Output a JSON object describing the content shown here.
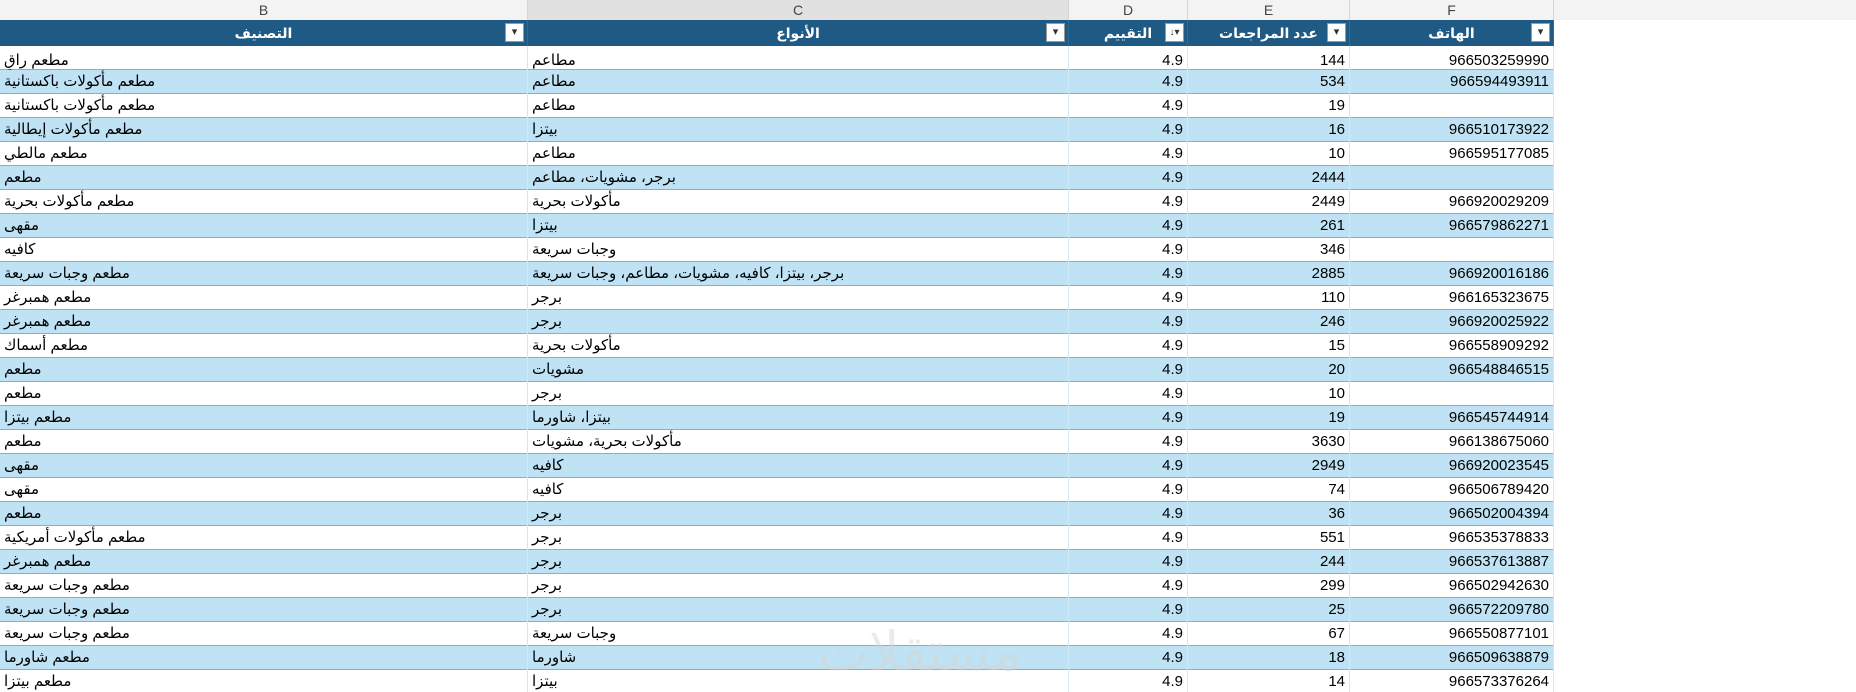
{
  "column_letters": [
    "B",
    "C",
    "D",
    "E",
    "F"
  ],
  "headers": {
    "B": "التصنيف",
    "C": "الأنواع",
    "D": "التقييم",
    "E": "عدد المراجعات",
    "F": "الهاتف"
  },
  "filter_icons": {
    "B": "filter-dropdown-icon",
    "C": "filter-dropdown-icon",
    "D": "sort-descending-filter-icon",
    "E": "filter-dropdown-icon",
    "F": "filter-dropdown-icon"
  },
  "filter_glyphs": {
    "dropdown": "▾",
    "sorted": "↓▾"
  },
  "rows": [
    {
      "category": "مطعم راقٍ",
      "types": "مطاعم",
      "rating": "4.9",
      "reviews": "144",
      "phone": "966503259990"
    },
    {
      "category": "مطعم مأكولات باكستانية",
      "types": "مطاعم",
      "rating": "4.9",
      "reviews": "534",
      "phone": "966594493911"
    },
    {
      "category": "مطعم مأكولات باكستانية",
      "types": "مطاعم",
      "rating": "4.9",
      "reviews": "19",
      "phone": ""
    },
    {
      "category": "مطعم مأكولات إيطالية",
      "types": "بيتزا",
      "rating": "4.9",
      "reviews": "16",
      "phone": "966510173922"
    },
    {
      "category": "مطعم مالطي",
      "types": "مطاعم",
      "rating": "4.9",
      "reviews": "10",
      "phone": "966595177085"
    },
    {
      "category": "مطعم",
      "types": "برجر، مشويات، مطاعم",
      "rating": "4.9",
      "reviews": "2444",
      "phone": ""
    },
    {
      "category": "مطعم مأكولات بحرية",
      "types": "مأكولات بحرية",
      "rating": "4.9",
      "reviews": "2449",
      "phone": "966920029209"
    },
    {
      "category": "مقهى",
      "types": "بيتزا",
      "rating": "4.9",
      "reviews": "261",
      "phone": "966579862271"
    },
    {
      "category": "كافيه",
      "types": "وجبات سريعة",
      "rating": "4.9",
      "reviews": "346",
      "phone": ""
    },
    {
      "category": "مطعم وجبات سريعة",
      "types": "برجر، بيتزا، كافيه، مشويات، مطاعم، وجبات سريعة",
      "rating": "4.9",
      "reviews": "2885",
      "phone": "966920016186"
    },
    {
      "category": "مطعم همبرغر",
      "types": "برجر",
      "rating": "4.9",
      "reviews": "110",
      "phone": "966165323675"
    },
    {
      "category": "مطعم همبرغر",
      "types": "برجر",
      "rating": "4.9",
      "reviews": "246",
      "phone": "966920025922"
    },
    {
      "category": "مطعم أسماك",
      "types": "مأكولات بحرية",
      "rating": "4.9",
      "reviews": "15",
      "phone": "966558909292"
    },
    {
      "category": "مطعم",
      "types": "مشويات",
      "rating": "4.9",
      "reviews": "20",
      "phone": "966548846515"
    },
    {
      "category": "مطعم",
      "types": "برجر",
      "rating": "4.9",
      "reviews": "10",
      "phone": ""
    },
    {
      "category": "مطعم بيتزا",
      "types": "بيتزا، شاورما",
      "rating": "4.9",
      "reviews": "19",
      "phone": "966545744914"
    },
    {
      "category": "مطعم",
      "types": "مأكولات بحرية، مشويات",
      "rating": "4.9",
      "reviews": "3630",
      "phone": "966138675060"
    },
    {
      "category": "مقهى",
      "types": "كافيه",
      "rating": "4.9",
      "reviews": "2949",
      "phone": "966920023545"
    },
    {
      "category": "مقهى",
      "types": "كافيه",
      "rating": "4.9",
      "reviews": "74",
      "phone": "966506789420"
    },
    {
      "category": "مطعم",
      "types": "برجر",
      "rating": "4.9",
      "reviews": "36",
      "phone": "966502004394"
    },
    {
      "category": "مطعم مأكولات أمريكية",
      "types": "برجر",
      "rating": "4.9",
      "reviews": "551",
      "phone": "966535378833"
    },
    {
      "category": "مطعم همبرغر",
      "types": "برجر",
      "rating": "4.9",
      "reviews": "244",
      "phone": "966537613887"
    },
    {
      "category": "مطعم وجبات سريعة",
      "types": "برجر",
      "rating": "4.9",
      "reviews": "299",
      "phone": "966502942630"
    },
    {
      "category": "مطعم وجبات سريعة",
      "types": "برجر",
      "rating": "4.9",
      "reviews": "25",
      "phone": "966572209780"
    },
    {
      "category": "مطعم وجبات سريعة",
      "types": "وجبات سريعة",
      "rating": "4.9",
      "reviews": "67",
      "phone": "966550877101"
    },
    {
      "category": "مطعم شاورما",
      "types": "شاورما",
      "rating": "4.9",
      "reviews": "18",
      "phone": "966509638879"
    },
    {
      "category": "مطعم بيتزا",
      "types": "بيتزا",
      "rating": "4.9",
      "reviews": "14",
      "phone": "966573376264"
    }
  ],
  "watermark": "مستقلات",
  "colors": {
    "header_bg": "#1f5a84",
    "band_row": "#bfe3f5",
    "grid_line": "#6fb6e0"
  }
}
